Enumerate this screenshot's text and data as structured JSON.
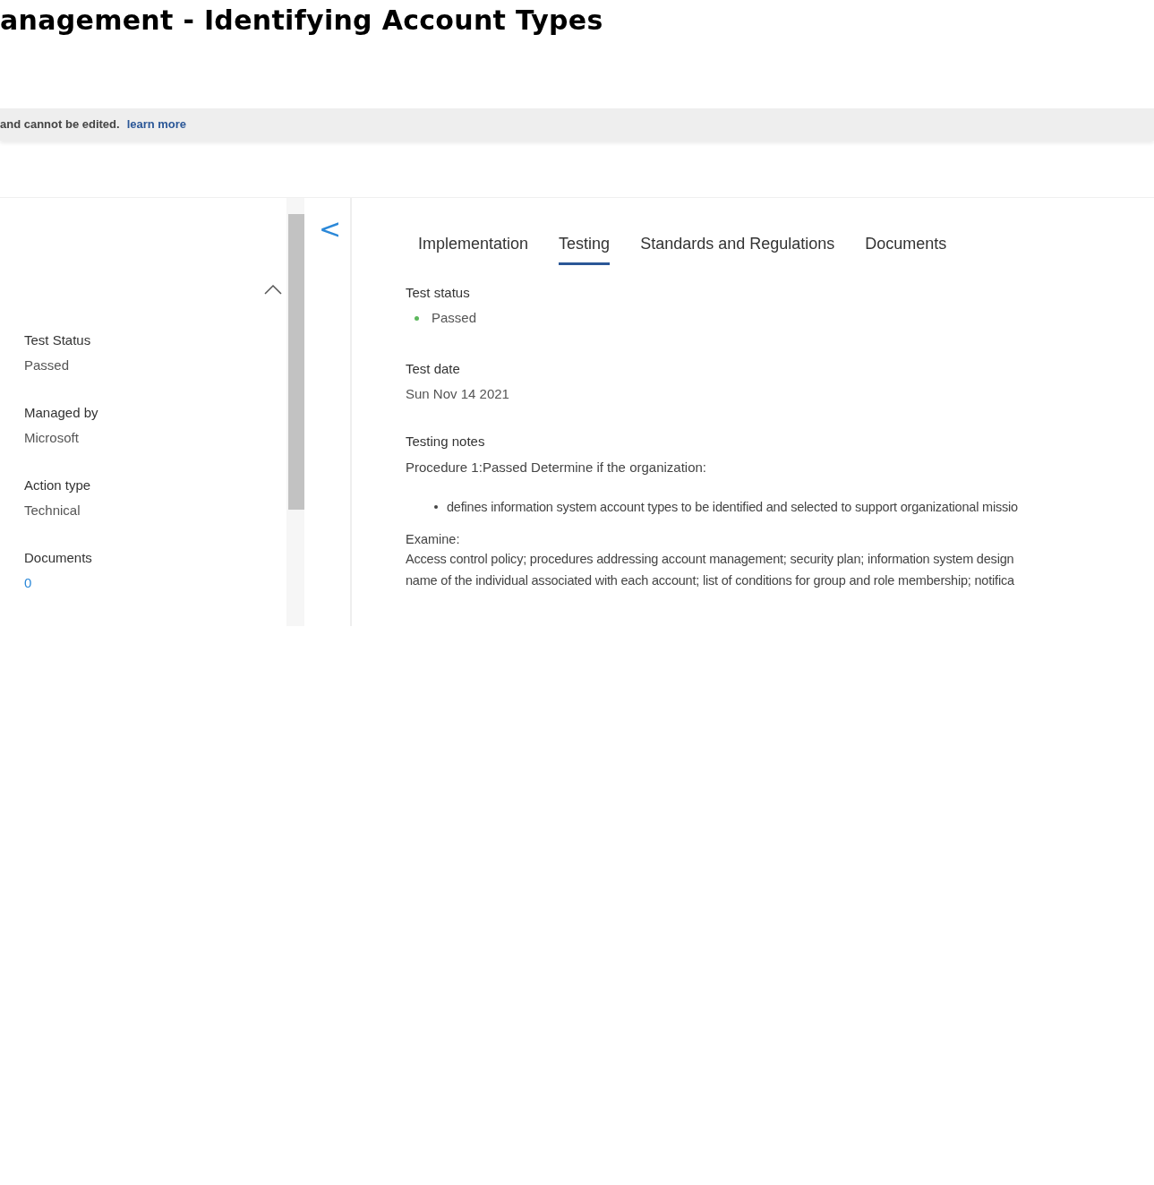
{
  "title": "anagement - Identifying Account Types",
  "banner": {
    "text": "and cannot be edited.",
    "link": "learn more"
  },
  "details": [
    {
      "label": "Test Status",
      "value": "Passed",
      "kind": "text"
    },
    {
      "label": "Managed by",
      "value": "Microsoft",
      "kind": "text"
    },
    {
      "label": "Action type",
      "value": "Technical",
      "kind": "text"
    },
    {
      "label": "Documents",
      "value": "0",
      "kind": "link"
    }
  ],
  "back_button": "<",
  "tabs": [
    {
      "label": "Implementation",
      "selected": false
    },
    {
      "label": "Testing",
      "selected": true
    },
    {
      "label": "Standards and Regulations",
      "selected": false
    },
    {
      "label": "Documents",
      "selected": false
    }
  ],
  "test_status": {
    "label": "Test status",
    "value": "Passed"
  },
  "test_date": {
    "label": "Test date",
    "value": "Sun Nov 14 2021"
  },
  "testing_notes": {
    "label": "Testing notes",
    "procedure": "Procedure 1:Passed Determine if the organization:",
    "bullets": [
      "defines information system account types to be identified and selected to support organizational missio"
    ],
    "examine_label": "Examine:",
    "examine_lines": [
      "Access control policy; procedures addressing account management; security plan; information system design",
      "name of the individual associated with each account; list of conditions for group and role membership; notifica"
    ]
  }
}
